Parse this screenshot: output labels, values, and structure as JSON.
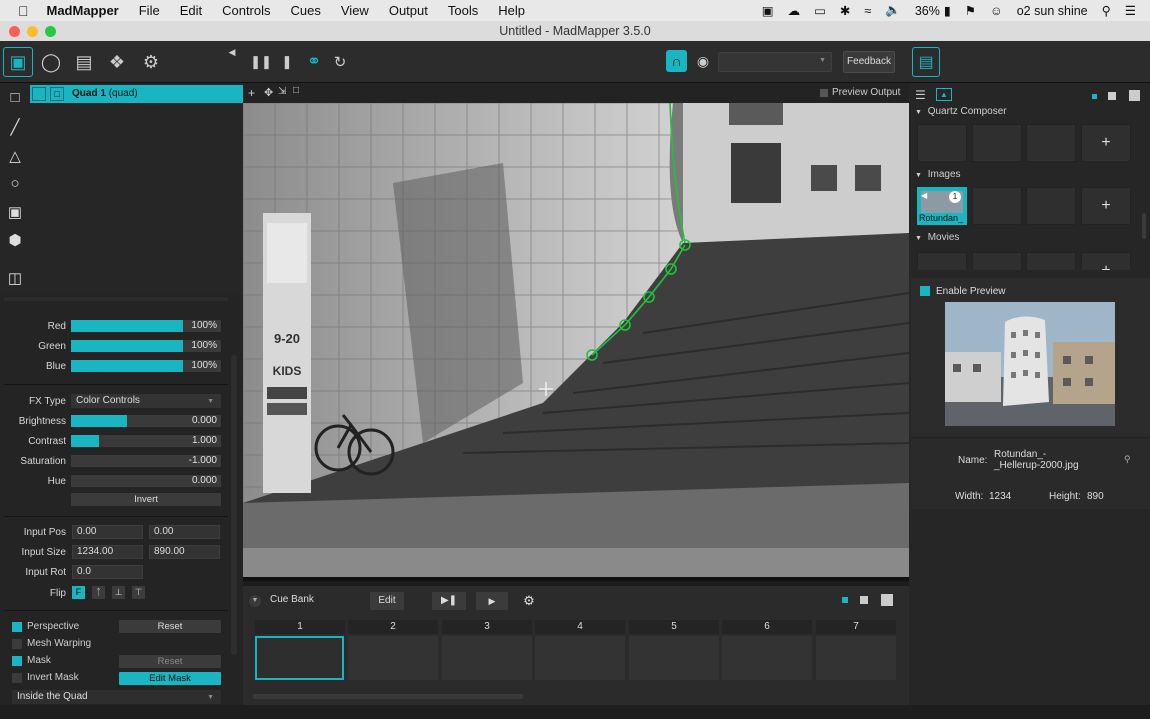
{
  "menubar": {
    "app_name": "MadMapper",
    "items": [
      "File",
      "Edit",
      "Controls",
      "Cues",
      "View",
      "Output",
      "Tools",
      "Help"
    ],
    "battery": "36%",
    "user": "o2 sun shine"
  },
  "window": {
    "title": "Untitled - MadMapper 3.5.0"
  },
  "toolbar": {
    "feedback_label": "Feedback"
  },
  "layers": {
    "selected_name": "Quad 1",
    "selected_type": "(quad)"
  },
  "colors": {
    "accent": "#19b5c2",
    "red_label": "Red",
    "red_value": "100%",
    "green_label": "Green",
    "green_value": "100%",
    "blue_label": "Blue",
    "blue_value": "100%"
  },
  "fx": {
    "type_label": "FX Type",
    "type_value": "Color Controls",
    "brightness_label": "Brightness",
    "brightness_value": "0.000",
    "contrast_label": "Contrast",
    "contrast_value": "1.000",
    "saturation_label": "Saturation",
    "saturation_value": "-1.000",
    "hue_label": "Hue",
    "hue_value": "0.000",
    "invert_label": "Invert"
  },
  "transform": {
    "input_pos_label": "Input Pos",
    "input_pos_x": "0.00",
    "input_pos_y": "0.00",
    "input_size_label": "Input Size",
    "input_size_w": "1234.00",
    "input_size_h": "890.00",
    "input_rot_label": "Input Rot",
    "input_rot": "0.0",
    "flip_label": "Flip"
  },
  "options": {
    "perspective": "Perspective",
    "reset1": "Reset",
    "mesh_warping": "Mesh Warping",
    "mask": "Mask",
    "reset2": "Reset",
    "invert_mask": "Invert Mask",
    "edit_mask": "Edit Mask",
    "mask_mode": "Inside the Quad"
  },
  "viewer": {
    "preview_output": "Preview Output"
  },
  "cuebank": {
    "title": "Cue Bank",
    "edit_label": "Edit",
    "columns": [
      "1",
      "2",
      "3",
      "4",
      "5",
      "6",
      "7"
    ]
  },
  "media": {
    "quartz_composer": "Quartz Composer",
    "images": "Images",
    "movies": "Movies",
    "thumb_label": "Rotundan_",
    "thumb_badge": "1",
    "enable_preview": "Enable Preview",
    "name_label": "Name:",
    "name_value_1": "Rotundan_-",
    "name_value_2": "_Hellerup-2000.jpg",
    "width_label": "Width:",
    "width_value": "1234",
    "height_label": "Height:",
    "height_value": "890"
  }
}
